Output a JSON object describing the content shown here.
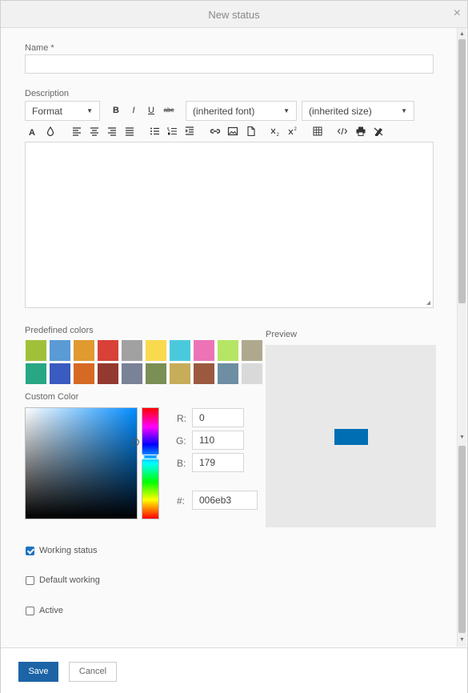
{
  "dialog": {
    "title": "New status",
    "close_symbol": "×"
  },
  "form": {
    "name_label": "Name *",
    "name_value": "",
    "description_label": "Description",
    "toolbar": {
      "format": "Format",
      "bold": "B",
      "italic": "I",
      "underline": "U",
      "strike": "abc",
      "font": "(inherited font)",
      "size": "(inherited size)"
    },
    "predefined_colors_label": "Predefined colors",
    "predefined_colors": [
      [
        "#a0c03a",
        "#5a9bd5",
        "#e09a30",
        "#d84137",
        "#a1a1a1",
        "#f9d94e",
        "#4bc9dc",
        "#ec73b5",
        "#b6e464",
        "#aea88f"
      ],
      [
        "#27a784",
        "#3a5bbf",
        "#d66a25",
        "#93392f",
        "#7a8298",
        "#7b8f55",
        "#c7ad5a",
        "#9b5a40",
        "#6d8ea3",
        "#d9d9d9"
      ]
    ],
    "custom_color_label": "Custom Color",
    "rgb": {
      "r_label": "R:",
      "g_label": "G:",
      "b_label": "B:",
      "hex_label": "#:",
      "r": "0",
      "g": "110",
      "b": "179",
      "hex": "006eb3"
    },
    "preview_label": "Preview",
    "preview_color": "#006eb3",
    "checkboxes": [
      {
        "label": "Working status",
        "checked": true
      },
      {
        "label": "Default working",
        "checked": false
      },
      {
        "label": "Active",
        "checked": false
      }
    ]
  },
  "footer": {
    "save": "Save",
    "cancel": "Cancel"
  },
  "colors": {
    "primary": "#1c64a6",
    "checkbox": "#1e73be"
  }
}
